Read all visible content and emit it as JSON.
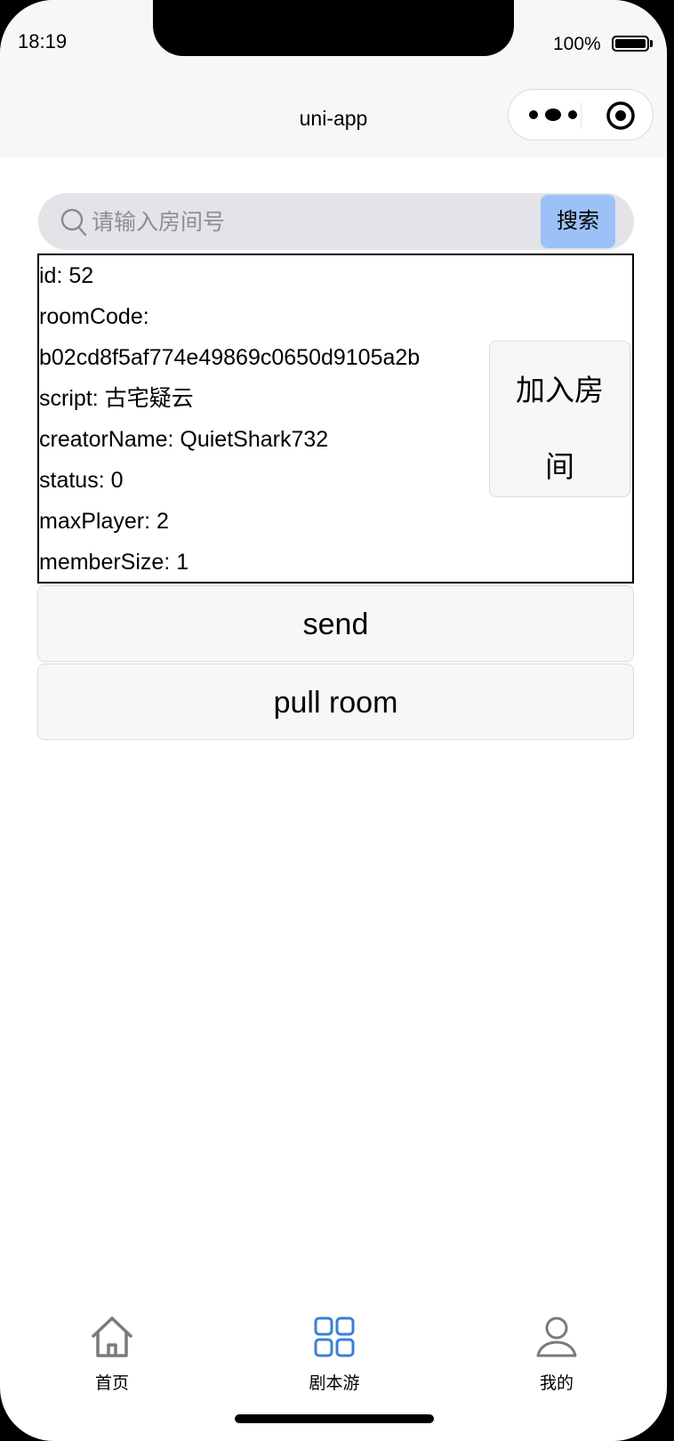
{
  "status_bar": {
    "time": "18:19",
    "battery": "100%"
  },
  "nav": {
    "title": "uni-app"
  },
  "search": {
    "placeholder": "请输入房间号",
    "value": "",
    "button_label": "搜索"
  },
  "room": {
    "rows": [
      "id: 52",
      "roomCode:",
      "b02cd8f5af774e49869c0650d9105a2b",
      "script: 古宅疑云",
      "creatorName: QuietShark732",
      "status: 0",
      "maxPlayer: 2",
      "memberSize: 1"
    ],
    "join_label": "加入房间"
  },
  "actions": {
    "send_label": "send",
    "pull_label": "pull room"
  },
  "tabbar": {
    "items": [
      {
        "label": "首页",
        "icon": "home-icon",
        "active": false
      },
      {
        "label": "剧本游",
        "icon": "grid-icon",
        "active": true
      },
      {
        "label": "我的",
        "icon": "user-icon",
        "active": false
      }
    ]
  },
  "colors": {
    "accent": "#3b7fd6",
    "search_button": "#9cc1f7",
    "tab_inactive": "#7a7a7a"
  }
}
